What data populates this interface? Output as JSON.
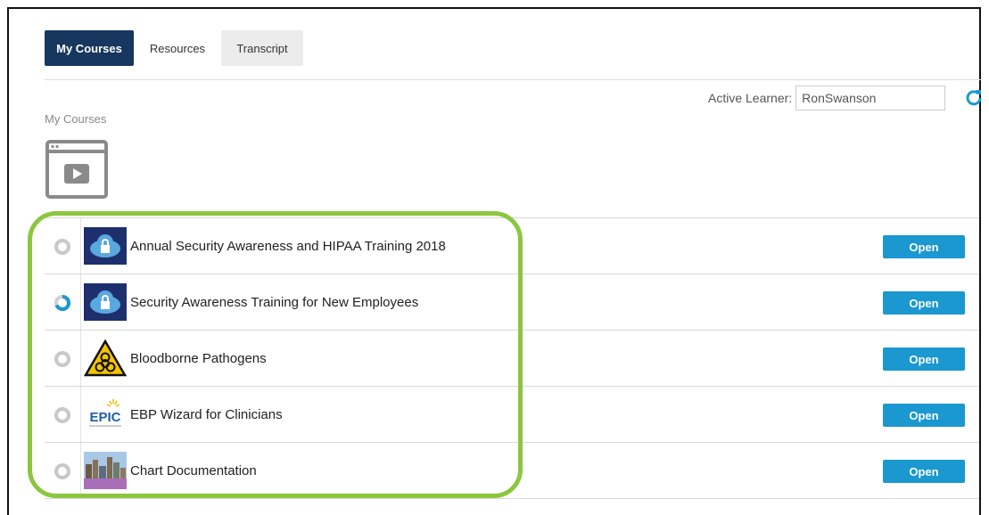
{
  "tabs": [
    {
      "label": "My Courses",
      "active": true
    },
    {
      "label": "Resources",
      "active": false
    },
    {
      "label": "Transcript",
      "active": false
    }
  ],
  "learner": {
    "label": "Active Learner:",
    "value": "RonSwanson"
  },
  "section_title": "My Courses",
  "courses": [
    {
      "title": "Annual Security Awareness and HIPAA Training 2018",
      "status": "not-started",
      "thumb": "cloud-lock-icon",
      "action": "Open"
    },
    {
      "title": "Security Awareness Training for New Employees",
      "status": "in-progress",
      "thumb": "cloud-lock-icon",
      "action": "Open"
    },
    {
      "title": "Bloodborne Pathogens",
      "status": "not-started",
      "thumb": "biohazard-icon",
      "action": "Open"
    },
    {
      "title": "EBP Wizard for Clinicians",
      "status": "not-started",
      "thumb": "epic-logo",
      "thumb_text": "EPIC",
      "action": "Open"
    },
    {
      "title": "Chart Documentation",
      "status": "not-started",
      "thumb": "cityscape-thumbnail",
      "action": "Open"
    }
  ],
  "colors": {
    "nav_active": "#17375e",
    "open_button": "#1a98cf",
    "highlight": "#8cc63f",
    "progress": "#1a98cf"
  }
}
